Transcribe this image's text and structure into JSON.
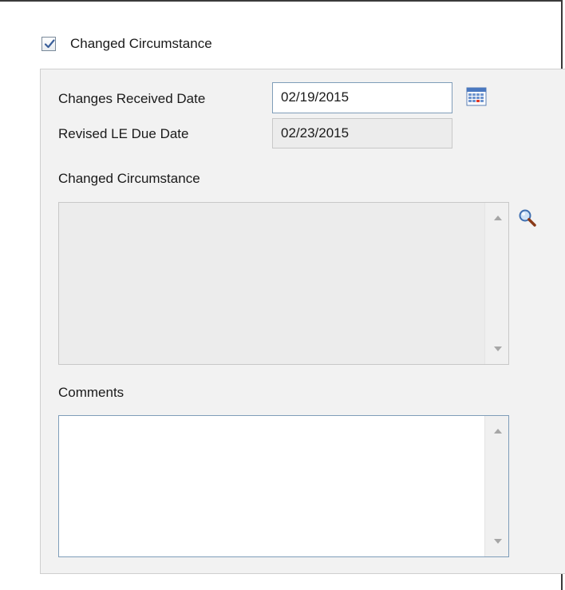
{
  "header": {
    "checkbox_checked": true,
    "checkbox_label": "Changed Circumstance"
  },
  "form": {
    "changes_received_date": {
      "label": "Changes Received Date",
      "value": "02/19/2015",
      "icon": "calendar-icon"
    },
    "revised_le_due_date": {
      "label": "Revised LE Due Date",
      "value": "02/23/2015"
    },
    "changed_circumstance": {
      "label": "Changed Circumstance",
      "value": "",
      "icon": "magnifier-icon"
    },
    "comments": {
      "label": "Comments",
      "value": ""
    }
  },
  "colors": {
    "panel_bg": "#f2f2f2",
    "input_border": "#7f9db9",
    "check_color": "#3a5f9a"
  }
}
